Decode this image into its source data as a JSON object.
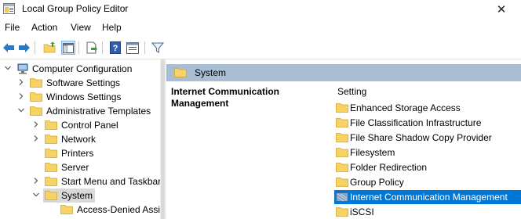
{
  "window": {
    "title": "Local Group Policy Editor",
    "close_glyph": "✕"
  },
  "menu": [
    "File",
    "Action",
    "View",
    "Help"
  ],
  "toolbar": [
    "back-icon",
    "forward-icon",
    "up-folder-icon",
    "show-hide-tree-icon",
    "export-list-icon",
    "help-icon",
    "properties-icon",
    "filter-icon"
  ],
  "tree": {
    "items": [
      {
        "label": "Computer Configuration",
        "level": 0,
        "expanded": true,
        "icon": "computer-icon"
      },
      {
        "label": "Software Settings",
        "level": 1,
        "expanded": false,
        "icon": "folder-icon"
      },
      {
        "label": "Windows Settings",
        "level": 1,
        "expanded": false,
        "icon": "folder-icon"
      },
      {
        "label": "Administrative Templates",
        "level": 1,
        "expanded": true,
        "icon": "folder-icon"
      },
      {
        "label": "Control Panel",
        "level": 2,
        "expanded": false,
        "icon": "folder-icon"
      },
      {
        "label": "Network",
        "level": 2,
        "expanded": false,
        "icon": "folder-icon"
      },
      {
        "label": "Printers",
        "level": 2,
        "expanded": null,
        "icon": "folder-icon"
      },
      {
        "label": "Server",
        "level": 2,
        "expanded": null,
        "icon": "folder-icon"
      },
      {
        "label": "Start Menu and Taskbar",
        "level": 2,
        "expanded": false,
        "icon": "folder-icon"
      },
      {
        "label": "System",
        "level": 2,
        "expanded": true,
        "icon": "folder-icon",
        "selected": true
      },
      {
        "label": "Access-Denied Assistance",
        "level": 3,
        "expanded": null,
        "icon": "folder-icon"
      }
    ]
  },
  "content": {
    "header": "System",
    "description_title": "Internet Communication Management",
    "column_header": "Setting",
    "items": [
      {
        "label": "Enhanced Storage Access",
        "icon": "folder-icon"
      },
      {
        "label": "File Classification Infrastructure",
        "icon": "folder-icon"
      },
      {
        "label": "File Share Shadow Copy Provider",
        "icon": "folder-icon"
      },
      {
        "label": "Filesystem",
        "icon": "folder-icon"
      },
      {
        "label": "Folder Redirection",
        "icon": "folder-icon"
      },
      {
        "label": "Group Policy",
        "icon": "folder-icon"
      },
      {
        "label": "Internet Communication Management",
        "icon": "folder-icon",
        "selected": true
      },
      {
        "label": "iSCSI",
        "icon": "folder-icon"
      }
    ]
  },
  "colors": {
    "header_band": "#a9bed3",
    "selection": "#0078d7",
    "tree_selection": "#d9d9d9",
    "folder": "#f7d266"
  }
}
